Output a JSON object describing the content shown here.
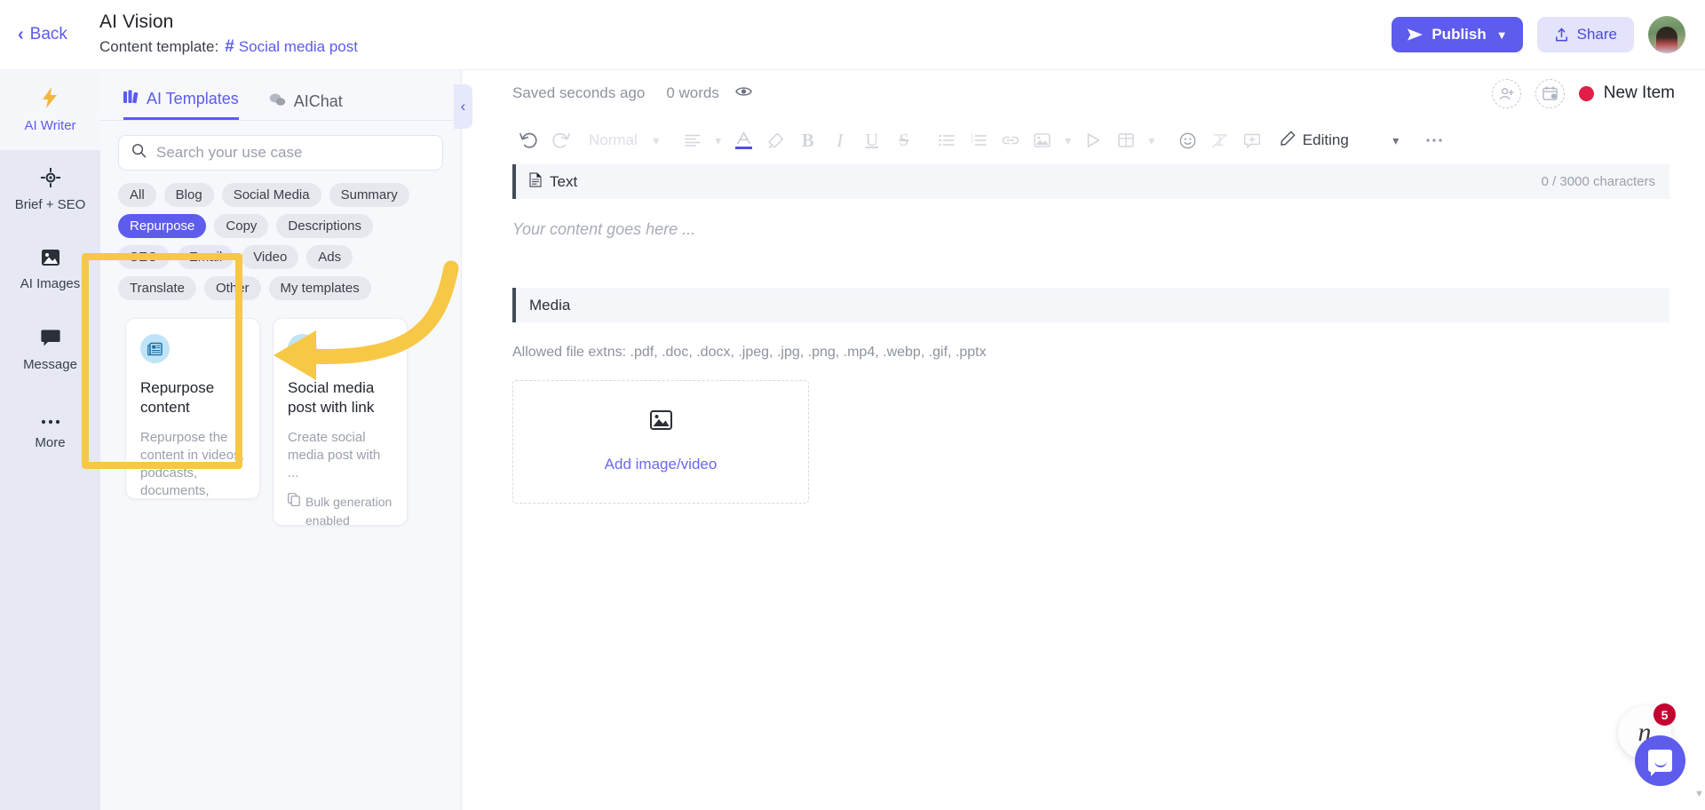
{
  "topbar": {
    "back_label": "Back",
    "back_icon": "chevron-left-icon",
    "title": "AI Vision",
    "subtitle_prefix": "Content template:",
    "template_name": "Social media post",
    "hash_icon": "#",
    "publish_label": "Publish",
    "publish_icon": "send-icon",
    "publish_caret_icon": "chevron-down-icon",
    "share_label": "Share",
    "share_icon": "upload-icon",
    "avatar_name": "user-avatar",
    "accent_color": "#5e5ced",
    "share_bg_color": "#e3e3fb"
  },
  "rail": {
    "items": [
      {
        "label": "AI Writer",
        "icon": "lightning-bolt-icon",
        "glyph": "⚡",
        "active": true
      },
      {
        "label": "Brief + SEO",
        "icon": "target-icon",
        "glyph": "⌖",
        "active": false
      },
      {
        "label": "AI Images",
        "icon": "image-icon",
        "glyph": "🖼",
        "active": false
      },
      {
        "label": "Message",
        "icon": "chat-bubble-icon",
        "glyph": "💬",
        "active": false
      },
      {
        "label": "More",
        "icon": "ellipsis-icon",
        "glyph": "•••",
        "active": false
      }
    ]
  },
  "templates_panel": {
    "tabs": [
      {
        "label": "AI Templates",
        "icon": "templates-grid-icon",
        "glyph": "▓",
        "active": true
      },
      {
        "label": "AIChat",
        "icon": "chat-icon",
        "glyph": "💭",
        "active": false
      }
    ],
    "search": {
      "placeholder": "Search your use case",
      "value": "",
      "icon": "search-icon"
    },
    "chips": [
      {
        "label": "All",
        "active": false
      },
      {
        "label": "Blog",
        "active": false
      },
      {
        "label": "Social Media",
        "active": false
      },
      {
        "label": "Summary",
        "active": false
      },
      {
        "label": "Repurpose",
        "active": true
      },
      {
        "label": "Copy",
        "active": false
      },
      {
        "label": "Descriptions",
        "active": false
      },
      {
        "label": "SEO",
        "active": false
      },
      {
        "label": "Email",
        "active": false
      },
      {
        "label": "Video",
        "active": false
      },
      {
        "label": "Ads",
        "active": false
      },
      {
        "label": "Translate",
        "active": false
      },
      {
        "label": "Other",
        "active": false
      },
      {
        "label": "My templates",
        "active": false
      }
    ],
    "cards": [
      {
        "title": "Repurpose content",
        "description": "Repurpose the content in videos, podcasts, documents,",
        "icon": "newspaper-icon",
        "glyph": "📰",
        "bulk": ""
      },
      {
        "title": "Social media post with link",
        "description": "Create social media post with ...",
        "icon": "hash-icon",
        "glyph": "#",
        "bulk": "Bulk generation enabled",
        "bulk_icon": "copy-icon"
      }
    ],
    "collapse_icon": "chevron-left-icon",
    "highlight_color": "#f7c846"
  },
  "editor": {
    "saved_text": "Saved seconds ago",
    "word_count": "0 words",
    "preview_icon": "eye-icon",
    "invite_icon": "add-user-icon",
    "schedule_icon": "calendar-add-icon",
    "status_label": "New Item",
    "status_color": "#e11d48",
    "toolbar": {
      "undo_icon": "undo-icon",
      "redo_icon": "redo-icon",
      "style_label": "Normal",
      "style_caret_icon": "chevron-down-icon",
      "align_icon": "align-left-icon",
      "align_caret_icon": "chevron-down-icon",
      "text_color_icon": "text-color-icon",
      "highlight_icon": "highlighter-icon",
      "bold_icon": "bold-icon",
      "italic_icon": "italic-icon",
      "underline_icon": "underline-icon",
      "strike_icon": "strikethrough-icon",
      "bullet_list_icon": "bullet-list-icon",
      "numbered_list_icon": "numbered-list-icon",
      "link_icon": "link-icon",
      "image_icon": "image-icon",
      "image_caret_icon": "chevron-down-icon",
      "video_icon": "play-icon",
      "table_icon": "table-icon",
      "table_caret_icon": "chevron-down-icon",
      "emoji_icon": "emoji-icon",
      "clear_format_icon": "clear-formatting-icon",
      "comment_icon": "add-comment-icon",
      "mode_icon": "pencil-icon",
      "mode_label": "Editing",
      "mode_caret_icon": "chevron-down-icon",
      "more_icon": "ellipsis-icon"
    },
    "text_section": {
      "label": "Text",
      "icon": "document-icon",
      "counter": "0 / 3000 characters",
      "placeholder": "Your content goes here ..."
    },
    "media_section": {
      "label": "Media",
      "allowed": "Allowed file extns: .pdf, .doc, .docx, .jpeg, .jpg, .png, .mp4, .webp, .gif, .pptx",
      "dropzone_icon": "image-icon",
      "dropzone_label": "Add image/video"
    }
  },
  "chat_widget": {
    "brand_letter": "n",
    "badge_count": "5",
    "fab_icon": "chat-smile-icon",
    "badge_color": "#c3002f"
  }
}
